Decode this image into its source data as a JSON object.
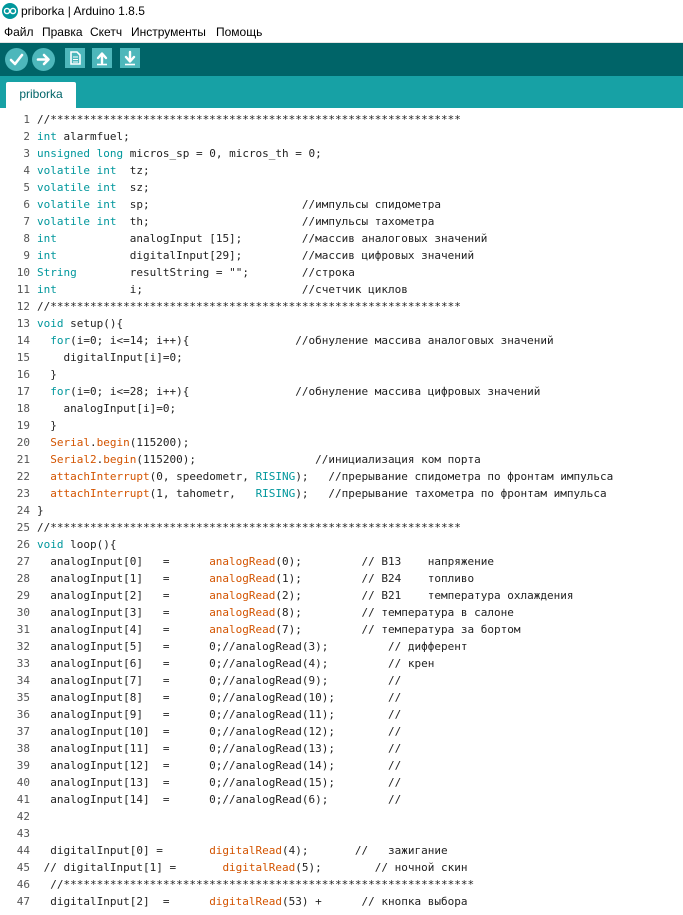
{
  "window": {
    "title": "priborka | Arduino 1.8.5",
    "logo_icon": "arduino-logo-icon"
  },
  "menu": [
    "Файл",
    "Правка",
    "Скетч",
    "Инструменты",
    "Помощь"
  ],
  "toolbar": [
    {
      "name": "verify-button",
      "icon": "checkmark-icon",
      "shape": "round"
    },
    {
      "name": "upload-button",
      "icon": "arrow-right-icon",
      "shape": "round"
    },
    {
      "name": "new-button",
      "icon": "new-file-icon",
      "shape": "square"
    },
    {
      "name": "open-button",
      "icon": "arrow-up-icon",
      "shape": "square"
    },
    {
      "name": "save-button",
      "icon": "arrow-down-icon",
      "shape": "square"
    }
  ],
  "tabs": [
    {
      "label": "priborka",
      "active": true
    }
  ],
  "colors": {
    "toolbar_bg": "#006468",
    "tabstrip_bg": "#17a1a5",
    "button_bg": "#4db7bb",
    "keyword": "#00979c",
    "function": "#d35400"
  },
  "code_lines": [
    {
      "n": "1",
      "text": "//**************************************************************"
    },
    {
      "n": "2",
      "text": "int alarmfuel;"
    },
    {
      "n": "3",
      "text": "unsigned long micros_sp = 0, micros_th = 0;"
    },
    {
      "n": "4",
      "text": "volatile int  tz;"
    },
    {
      "n": "5",
      "text": "volatile int  sz;"
    },
    {
      "n": "6",
      "text": "volatile int  sp;                       //импульсы спидометра"
    },
    {
      "n": "7",
      "text": "volatile int  th;                       //импульсы тахометра"
    },
    {
      "n": "8",
      "text": "int           analogInput [15];         //массив аналоговых значений"
    },
    {
      "n": "9",
      "text": "int           digitalInput[29];         //массив цифровых значений"
    },
    {
      "n": "10",
      "text": "String        resultString = \"\";        //строка"
    },
    {
      "n": "11",
      "text": "int           i;                        //счетчик циклов"
    },
    {
      "n": "12",
      "text": "//**************************************************************"
    },
    {
      "n": "13",
      "text": "void setup(){"
    },
    {
      "n": "14",
      "text": "  for(i=0; i<=14; i++){                //обнуление массива аналоговых значений"
    },
    {
      "n": "15",
      "text": "    digitalInput[i]=0;"
    },
    {
      "n": "16",
      "text": "  }"
    },
    {
      "n": "17",
      "text": "  for(i=0; i<=28; i++){                //обнуление массива цифровых значений"
    },
    {
      "n": "18",
      "text": "    analogInput[i]=0;"
    },
    {
      "n": "19",
      "text": "  }"
    },
    {
      "n": "20",
      "text": "  Serial.begin(115200);"
    },
    {
      "n": "21",
      "text": "  Serial2.begin(115200);                  //инициализация ком порта"
    },
    {
      "n": "22",
      "text": "  attachInterrupt(0, speedometr, RISING);   //прерывание спидометра по фронтам импульса"
    },
    {
      "n": "23",
      "text": "  attachInterrupt(1, tahometr,   RISING);   //прерывание тахометра по фронтам импульса"
    },
    {
      "n": "24",
      "text": "}"
    },
    {
      "n": "25",
      "text": "//**************************************************************"
    },
    {
      "n": "26",
      "text": "void loop(){"
    },
    {
      "n": "27",
      "text": "  analogInput[0]   =      analogRead(0);         // B13    напряжение"
    },
    {
      "n": "28",
      "text": "  analogInput[1]   =      analogRead(1);         // B24    топливо"
    },
    {
      "n": "29",
      "text": "  analogInput[2]   =      analogRead(2);         // B21    температура охлаждения"
    },
    {
      "n": "30",
      "text": "  analogInput[3]   =      analogRead(8);         // температура в салоне"
    },
    {
      "n": "31",
      "text": "  analogInput[4]   =      analogRead(7);         // температура за бортом"
    },
    {
      "n": "32",
      "text": "  analogInput[5]   =      0;//analogRead(3);         // дифферент"
    },
    {
      "n": "33",
      "text": "  analogInput[6]   =      0;//analogRead(4);         // крен"
    },
    {
      "n": "34",
      "text": "  analogInput[7]   =      0;//analogRead(9);         //"
    },
    {
      "n": "35",
      "text": "  analogInput[8]   =      0;//analogRead(10);        //"
    },
    {
      "n": "36",
      "text": "  analogInput[9]   =      0;//analogRead(11);        //"
    },
    {
      "n": "37",
      "text": "  analogInput[10]  =      0;//analogRead(12);        //"
    },
    {
      "n": "38",
      "text": "  analogInput[11]  =      0;//analogRead(13);        //"
    },
    {
      "n": "39",
      "text": "  analogInput[12]  =      0;//analogRead(14);        //"
    },
    {
      "n": "40",
      "text": "  analogInput[13]  =      0;//analogRead(15);        //"
    },
    {
      "n": "41",
      "text": "  analogInput[14]  =      0;//analogRead(6);         //"
    },
    {
      "n": "42",
      "text": ""
    },
    {
      "n": "43",
      "text": ""
    },
    {
      "n": "44",
      "text": "  digitalInput[0] =       digitalRead(4);       //   зажигание"
    },
    {
      "n": "45",
      "text": " // digitalInput[1] =       digitalRead(5);        // ночной скин"
    },
    {
      "n": "46",
      "text": "  //**************************************************************"
    },
    {
      "n": "47",
      "text": "  digitalInput[2]  =      digitalRead(53) +      // кнопка выбора"
    }
  ]
}
